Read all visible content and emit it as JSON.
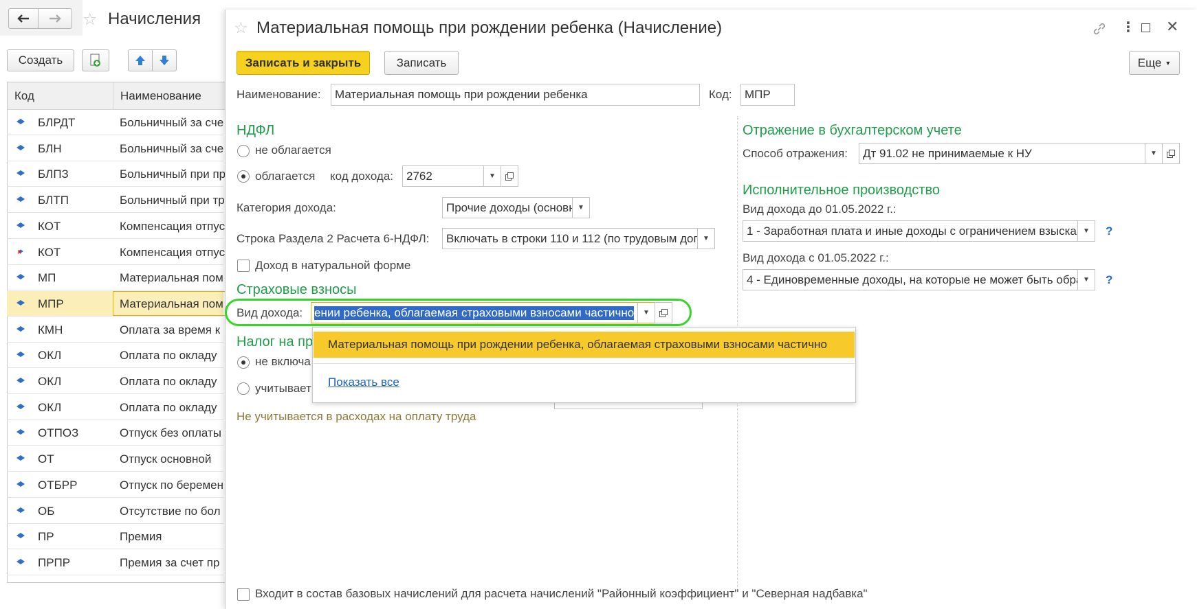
{
  "list_window": {
    "title": "Начисления",
    "create_label": "Создать",
    "columns": {
      "code": "Код",
      "name": "Наименование"
    },
    "rows": [
      {
        "code": "БЛРДТ",
        "name": "Больничный за сче"
      },
      {
        "code": "БЛН",
        "name": "Больничный за сче"
      },
      {
        "code": "БЛПЗ",
        "name": "Больничный при пр"
      },
      {
        "code": "БЛТП",
        "name": "Больничный при тр"
      },
      {
        "code": "КОТ",
        "name": "Компенсация отпус"
      },
      {
        "code": "КОТ",
        "name": "Компенсация отпус"
      },
      {
        "code": "МП",
        "name": "Материальная пом"
      },
      {
        "code": "МПР",
        "name": "Материальная пом"
      },
      {
        "code": "КМН",
        "name": "Оплата за время к"
      },
      {
        "code": "ОКЛ",
        "name": "Оплата по окладу"
      },
      {
        "code": "ОКЛ",
        "name": "Оплата по окладу"
      },
      {
        "code": "ОКЛ",
        "name": "Оплата по окладу"
      },
      {
        "code": "ОТПОЗ",
        "name": "Отпуск без оплаты"
      },
      {
        "code": "ОТ",
        "name": "Отпуск основной"
      },
      {
        "code": "ОТБРР",
        "name": "Отпуск по беремен"
      },
      {
        "code": "ОБ",
        "name": "Отсутствие по бол"
      },
      {
        "code": "ПР",
        "name": "Премия"
      },
      {
        "code": "ПРПР",
        "name": "Премия за счет пр"
      }
    ]
  },
  "form": {
    "title": "Материальная помощь при рождении ребенка (Начисление)",
    "save_close_label": "Записать и закрыть",
    "save_label": "Записать",
    "more_label": "Еще",
    "name_label": "Наименование:",
    "name_value": "Материальная помощь при рождении ребенка",
    "code_label": "Код:",
    "code_value": "МПР",
    "ndfl": {
      "heading": "НДФЛ",
      "not_taxed": "не облагается",
      "taxed": "облагается",
      "income_code_label": "код дохода:",
      "income_code_value": "2762",
      "category_label": "Категория дохода:",
      "category_value": "Прочие доходы (основна",
      "row_label": "Строка Раздела 2 Расчета 6-НДФЛ:",
      "row_value": "Включать в строки 110 и 112 (по трудовым дог",
      "in_kind": "Доход в натуральной форме"
    },
    "insurance": {
      "heading": "Страховые взносы",
      "income_type_label": "Вид дохода:",
      "income_type_value": "ении ребенка, облагаемая страховыми взносами частично"
    },
    "profit_tax": {
      "heading": "Налог на пр",
      "opt1": "не включа",
      "opt2": "учитывает",
      "note": "Не учитывается в расходах на оплату труда"
    },
    "accounting": {
      "heading": "Отражение в бухгалтерском учете",
      "method_label": "Способ отражения:",
      "method_value": "Дт 91.02 не принимаемые к НУ"
    },
    "enforcement": {
      "heading": "Исполнительное производство",
      "before_label": "Вид дохода до 01.05.2022 г.:",
      "before_value": "1 - Заработная плата и иные доходы с ограничением взыскан",
      "after_label": "Вид дохода с 01.05.2022 г.:",
      "after_value": "4 - Единовременные доходы, на которые не может быть обра"
    },
    "base_check": "Входит в состав базовых начислений для расчета начислений \"Районный коэффициент\" и \"Северная надбавка\"",
    "dropdown": {
      "item": "Материальная помощь при рождении ребенка, облагаемая страховыми взносами частично",
      "show_all": "Показать все"
    }
  },
  "colors": {
    "accent_green": "#1f9d4a",
    "highlight_yellow": "#f7c92a",
    "selection_blue": "#3169c6",
    "ring_green": "#35d62a"
  }
}
